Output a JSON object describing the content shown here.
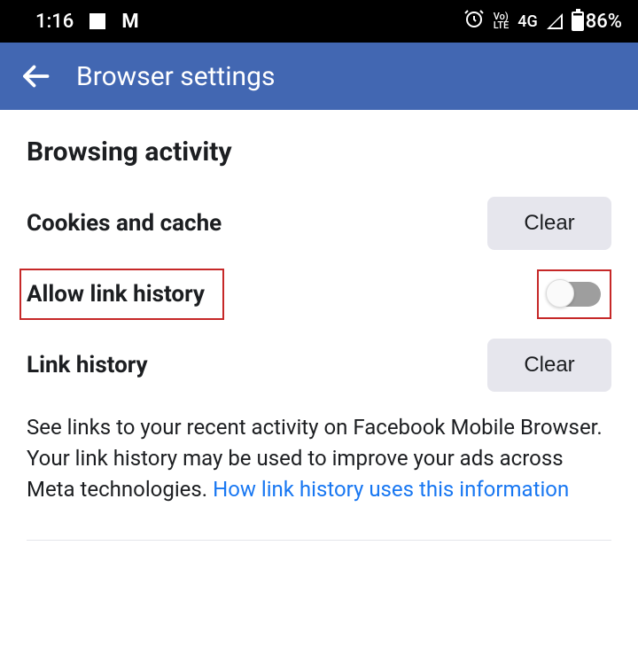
{
  "status_bar": {
    "time": "1:16",
    "gmail_icon": "M",
    "volte_top": "Vo)",
    "volte_bottom": "LTE",
    "signal_label": "4G",
    "battery": "86%"
  },
  "app_bar": {
    "title": "Browser settings"
  },
  "content": {
    "section_title": "Browsing activity",
    "rows": [
      {
        "label": "Cookies and cache",
        "action_label": "Clear"
      },
      {
        "label": "Allow link history"
      },
      {
        "label": "Link history",
        "action_label": "Clear"
      }
    ],
    "description_text": "See links to your recent activity on Facebook Mobile Browser. Your link history may be used to improve your ads across Meta technologies. ",
    "description_link": "How link history uses this information"
  }
}
